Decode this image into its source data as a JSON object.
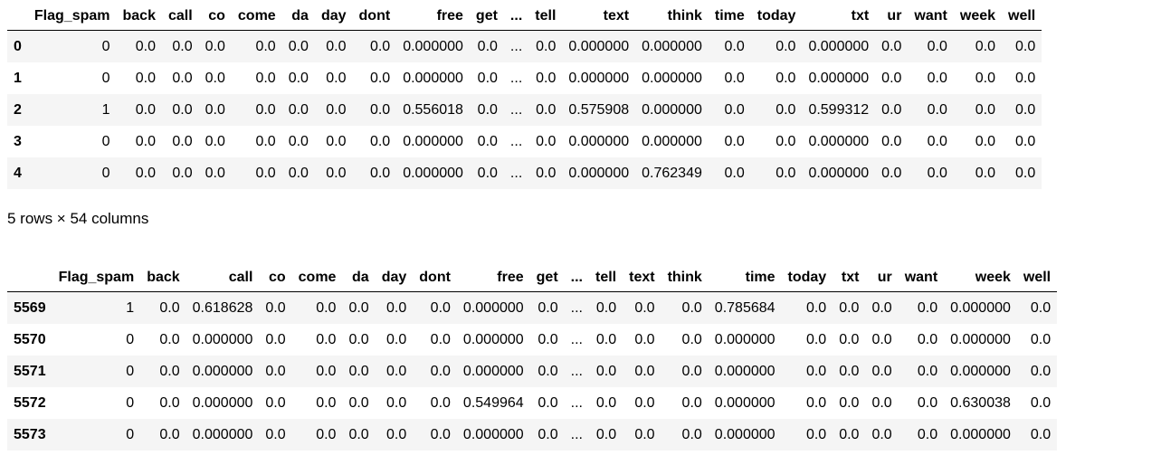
{
  "frame1": {
    "columns": [
      "",
      "Flag_spam",
      "back",
      "call",
      "co",
      "come",
      "da",
      "day",
      "dont",
      "free",
      "get",
      "...",
      "tell",
      "text",
      "think",
      "time",
      "today",
      "txt",
      "ur",
      "want",
      "week",
      "well"
    ],
    "rows": [
      [
        "0",
        "0",
        "0.0",
        "0.0",
        "0.0",
        "0.0",
        "0.0",
        "0.0",
        "0.0",
        "0.000000",
        "0.0",
        "...",
        "0.0",
        "0.000000",
        "0.000000",
        "0.0",
        "0.0",
        "0.000000",
        "0.0",
        "0.0",
        "0.0",
        "0.0"
      ],
      [
        "1",
        "0",
        "0.0",
        "0.0",
        "0.0",
        "0.0",
        "0.0",
        "0.0",
        "0.0",
        "0.000000",
        "0.0",
        "...",
        "0.0",
        "0.000000",
        "0.000000",
        "0.0",
        "0.0",
        "0.000000",
        "0.0",
        "0.0",
        "0.0",
        "0.0"
      ],
      [
        "2",
        "1",
        "0.0",
        "0.0",
        "0.0",
        "0.0",
        "0.0",
        "0.0",
        "0.0",
        "0.556018",
        "0.0",
        "...",
        "0.0",
        "0.575908",
        "0.000000",
        "0.0",
        "0.0",
        "0.599312",
        "0.0",
        "0.0",
        "0.0",
        "0.0"
      ],
      [
        "3",
        "0",
        "0.0",
        "0.0",
        "0.0",
        "0.0",
        "0.0",
        "0.0",
        "0.0",
        "0.000000",
        "0.0",
        "...",
        "0.0",
        "0.000000",
        "0.000000",
        "0.0",
        "0.0",
        "0.000000",
        "0.0",
        "0.0",
        "0.0",
        "0.0"
      ],
      [
        "4",
        "0",
        "0.0",
        "0.0",
        "0.0",
        "0.0",
        "0.0",
        "0.0",
        "0.0",
        "0.000000",
        "0.0",
        "...",
        "0.0",
        "0.000000",
        "0.762349",
        "0.0",
        "0.0",
        "0.000000",
        "0.0",
        "0.0",
        "0.0",
        "0.0"
      ]
    ]
  },
  "caption": "5 rows × 54 columns",
  "frame2": {
    "columns": [
      "",
      "Flag_spam",
      "back",
      "call",
      "co",
      "come",
      "da",
      "day",
      "dont",
      "free",
      "get",
      "...",
      "tell",
      "text",
      "think",
      "time",
      "today",
      "txt",
      "ur",
      "want",
      "week",
      "well"
    ],
    "rows": [
      [
        "5569",
        "1",
        "0.0",
        "0.618628",
        "0.0",
        "0.0",
        "0.0",
        "0.0",
        "0.0",
        "0.000000",
        "0.0",
        "...",
        "0.0",
        "0.0",
        "0.0",
        "0.785684",
        "0.0",
        "0.0",
        "0.0",
        "0.0",
        "0.000000",
        "0.0"
      ],
      [
        "5570",
        "0",
        "0.0",
        "0.000000",
        "0.0",
        "0.0",
        "0.0",
        "0.0",
        "0.0",
        "0.000000",
        "0.0",
        "...",
        "0.0",
        "0.0",
        "0.0",
        "0.000000",
        "0.0",
        "0.0",
        "0.0",
        "0.0",
        "0.000000",
        "0.0"
      ],
      [
        "5571",
        "0",
        "0.0",
        "0.000000",
        "0.0",
        "0.0",
        "0.0",
        "0.0",
        "0.0",
        "0.000000",
        "0.0",
        "...",
        "0.0",
        "0.0",
        "0.0",
        "0.000000",
        "0.0",
        "0.0",
        "0.0",
        "0.0",
        "0.000000",
        "0.0"
      ],
      [
        "5572",
        "0",
        "0.0",
        "0.000000",
        "0.0",
        "0.0",
        "0.0",
        "0.0",
        "0.0",
        "0.549964",
        "0.0",
        "...",
        "0.0",
        "0.0",
        "0.0",
        "0.000000",
        "0.0",
        "0.0",
        "0.0",
        "0.0",
        "0.630038",
        "0.0"
      ],
      [
        "5573",
        "0",
        "0.0",
        "0.000000",
        "0.0",
        "0.0",
        "0.0",
        "0.0",
        "0.0",
        "0.000000",
        "0.0",
        "...",
        "0.0",
        "0.0",
        "0.0",
        "0.000000",
        "0.0",
        "0.0",
        "0.0",
        "0.0",
        "0.000000",
        "0.0"
      ]
    ]
  }
}
